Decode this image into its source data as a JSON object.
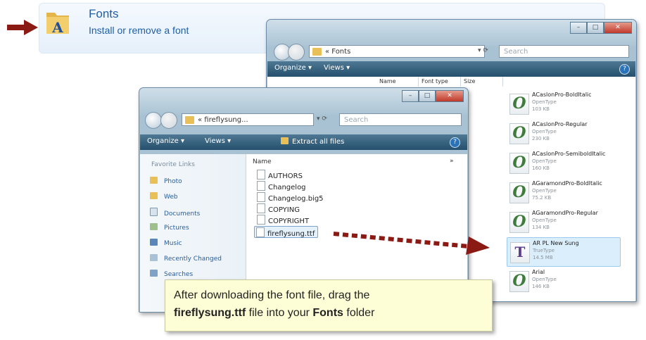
{
  "header": {
    "title": "Fonts",
    "subtitle": "Install or remove a font"
  },
  "fonts_window": {
    "address": "« Fonts",
    "search_placeholder": "Search",
    "toolbar": {
      "organize": "Organize ▾",
      "views": "Views ▾"
    },
    "columns": {
      "name": "Name",
      "font_type": "Font type",
      "size": "Size"
    },
    "fonts": [
      {
        "name": "ACaslonPro-BoldItalic",
        "type": "OpenType",
        "size": "103 KB",
        "icon": "opentype-icon"
      },
      {
        "name": "ACaslonPro-Regular",
        "type": "OpenType",
        "size": "230 KB",
        "icon": "opentype-icon"
      },
      {
        "name": "ACaslonPro-SemiboldItalic",
        "type": "OpenType",
        "size": "160 KB",
        "icon": "opentype-icon"
      },
      {
        "name": "AGaramondPro-BoldItalic",
        "type": "OpenType",
        "size": "75.2 KB",
        "icon": "opentype-icon"
      },
      {
        "name": "AGaramondPro-Regular",
        "type": "OpenType",
        "size": "134 KB",
        "icon": "opentype-icon"
      },
      {
        "name": "AR PL New Sung",
        "type": "TrueType",
        "size": "14.5 MB",
        "icon": "truetype-icon"
      },
      {
        "name": "Arial",
        "type": "OpenType",
        "size": "146 KB",
        "icon": "opentype-icon"
      }
    ]
  },
  "fireflysung_window": {
    "address": "« fireflysung...",
    "search_placeholder": "Search",
    "toolbar": {
      "organize": "Organize ▾",
      "views": "Views ▾",
      "extract": "Extract all files"
    },
    "favorite_links_title": "Favorite Links",
    "favorites": [
      "Photo",
      "Web",
      "Documents",
      "Pictures",
      "Music",
      "Recently Changed",
      "Searches"
    ],
    "name_column": "Name",
    "column_chevron": "»",
    "files": [
      "AUTHORS",
      "Changelog",
      "Changelog.big5",
      "COPYING",
      "COPYRIGHT",
      "fireflysung.ttf"
    ]
  },
  "callout": {
    "line1": "After downloading the font file, drag the",
    "bold_file": "fireflysung.ttf",
    "mid": " file into your ",
    "bold_folder": "Fonts",
    "end": " folder"
  },
  "colors": {
    "arrow_red": "#8b1a14",
    "link_blue": "#1e5fa8",
    "callout_bg": "#fefed6"
  }
}
